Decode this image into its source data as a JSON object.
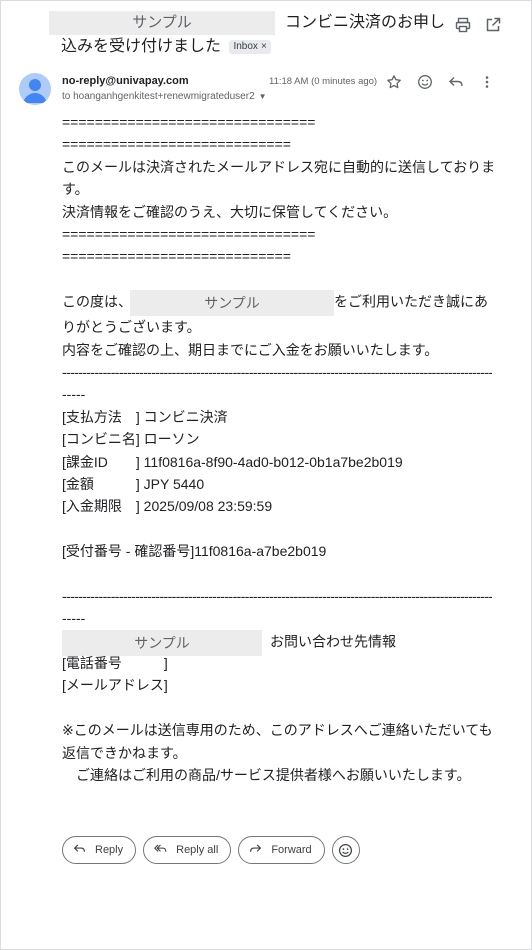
{
  "subject": {
    "redaction_label": "サンプル",
    "text": "コンビニ決済のお申し込みを受け付けました",
    "label_chip": "Inbox",
    "label_chip_close": "×"
  },
  "header": {
    "sender_email": "no-reply@univapay.com",
    "to": "to hoanganhgenkitest+renewmigrateduser2",
    "timestamp": "11:18 AM (0 minutes ago)"
  },
  "body": {
    "separator_a": "===============================",
    "separator_b": "============================",
    "intro": "このメールは決済されたメールアドレス宛に自動的に送信しております。",
    "keep_notice": "決済情報をご確認のうえ、大切に保管してください。",
    "thanks_prefix": "この度は、",
    "thanks_redaction": "サンプル",
    "thanks_suffix": "をご利用いただき誠にありがとうございます。",
    "confirm_notice": "内容をご確認の上、期日までにご入金をお願いいたします。",
    "dash_line": "-------------------------------------------------------------------------------------------------------------",
    "dash_tail": "-----",
    "payment_method": "[支払方法　] コンビニ決済",
    "store_name": "[コンビニ名] ローソン",
    "billing_id": "[課金ID　　] 11f0816a-8f90-4ad0-b012-0b1a7be2b019",
    "amount": "[金額　　　] JPY 5440",
    "deadline": "[入金期限　] 2025/09/08 23:59:59",
    "receipt_number": "[受付番号 - 確認番号]11f0816a-a7be2b019",
    "contact_redaction": "サンプル",
    "contact_title": "お問い合わせ先情報",
    "phone": "[電話番号　　　]",
    "email_label": "[メールアドレス]",
    "disclaimer": "※このメールは送信専用のため、このアドレスへご連絡いただいても返信できかねます。",
    "disclaimer2": "　ご連絡はご利用の商品/サービス提供者様へお願いいたします。"
  },
  "actions": {
    "reply": "Reply",
    "reply_all": "Reply all",
    "forward": "Forward"
  },
  "icons": [
    "print-icon",
    "open-in-new-window-icon",
    "star-icon",
    "emoji-icon",
    "reply-icon",
    "more-vert-icon",
    "reply-all-icon",
    "forward-icon",
    "avatar-person-icon"
  ],
  "colors": {
    "avatar_bg": "#aecbfa",
    "avatar_fg": "#4285f4",
    "redaction_bg": "#ececec"
  }
}
